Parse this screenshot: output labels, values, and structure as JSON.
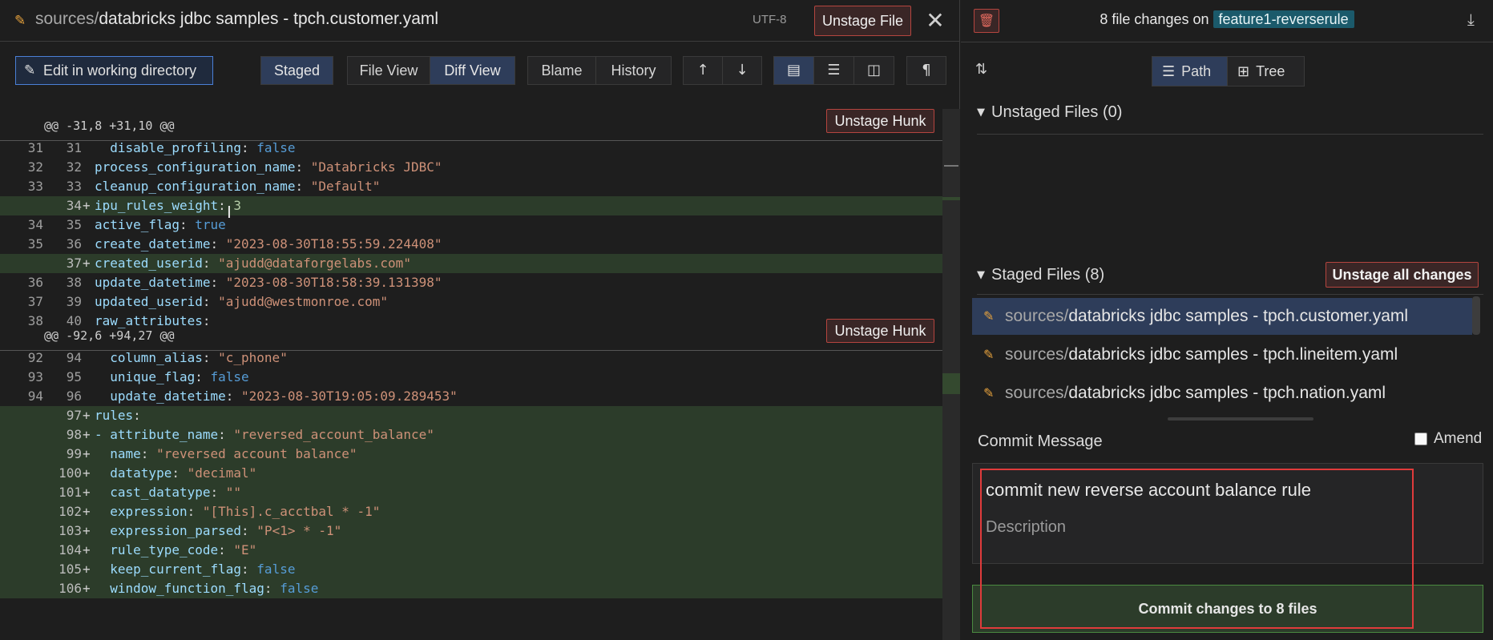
{
  "left": {
    "title_dir": "sources/",
    "title_file": "databricks jdbc samples - tpch.customer.yaml",
    "encoding": "UTF-8",
    "unstage_file_label": "Unstage File",
    "close_glyph": "✕",
    "toolbar": {
      "edit_label": "Edit in working directory",
      "staged_label": "Staged",
      "file_view_label": "File View",
      "diff_view_label": "Diff View",
      "blame_label": "Blame",
      "history_label": "History",
      "up_glyph": "🡡",
      "down_glyph": "🡣"
    },
    "hunks": [
      {
        "header": "@@ -31,8 +31,10 @@",
        "unstage_label": "Unstage Hunk",
        "lines": [
          {
            "o": "31",
            "n": "31",
            "m": "",
            "key": "  disable_profiling",
            "val": "false",
            "vt": "b"
          },
          {
            "o": "32",
            "n": "32",
            "m": "",
            "key": "process_configuration_name",
            "val": "\"Databricks JDBC\"",
            "vt": "s"
          },
          {
            "o": "33",
            "n": "33",
            "m": "",
            "key": "cleanup_configuration_name",
            "val": "\"Default\"",
            "vt": "s"
          },
          {
            "o": "",
            "n": "34",
            "m": "+",
            "key": "ipu_rules_weight",
            "val": "3",
            "vt": "n"
          },
          {
            "o": "34",
            "n": "35",
            "m": "",
            "key": "active_flag",
            "val": "true",
            "vt": "b"
          },
          {
            "o": "35",
            "n": "36",
            "m": "",
            "key": "create_datetime",
            "val": "\"2023-08-30T18:55:59.224408\"",
            "vt": "s"
          },
          {
            "o": "",
            "n": "37",
            "m": "+",
            "key": "created_userid",
            "val": "\"ajudd@dataforgelabs.com\"",
            "vt": "s"
          },
          {
            "o": "36",
            "n": "38",
            "m": "",
            "key": "update_datetime",
            "val": "\"2023-08-30T18:58:39.131398\"",
            "vt": "s"
          },
          {
            "o": "37",
            "n": "39",
            "m": "",
            "key": "updated_userid",
            "val": "\"ajudd@westmonroe.com\"",
            "vt": "s"
          },
          {
            "o": "38",
            "n": "40",
            "m": "",
            "key": "raw_attributes",
            "val": "",
            "vt": "p"
          }
        ]
      },
      {
        "header": "@@ -92,6 +94,27 @@",
        "unstage_label": "Unstage Hunk",
        "lines": [
          {
            "o": "92",
            "n": "94",
            "m": "",
            "key": "  column_alias",
            "val": "\"c_phone\"",
            "vt": "s"
          },
          {
            "o": "93",
            "n": "95",
            "m": "",
            "key": "  unique_flag",
            "val": "false",
            "vt": "b"
          },
          {
            "o": "94",
            "n": "96",
            "m": "",
            "key": "  update_datetime",
            "val": "\"2023-08-30T19:05:09.289453\"",
            "vt": "s"
          },
          {
            "o": "",
            "n": "97",
            "m": "+",
            "key": "rules",
            "val": "",
            "vt": "p"
          },
          {
            "o": "",
            "n": "98",
            "m": "+",
            "key": "- attribute_name",
            "val": "\"reversed_account_balance\"",
            "vt": "s"
          },
          {
            "o": "",
            "n": "99",
            "m": "+",
            "key": "  name",
            "val": "\"reversed account balance\"",
            "vt": "s"
          },
          {
            "o": "",
            "n": "100",
            "m": "+",
            "key": "  datatype",
            "val": "\"decimal\"",
            "vt": "s"
          },
          {
            "o": "",
            "n": "101",
            "m": "+",
            "key": "  cast_datatype",
            "val": "\"\"",
            "vt": "s"
          },
          {
            "o": "",
            "n": "102",
            "m": "+",
            "key": "  expression",
            "val": "\"[This].c_acctbal * -1\"",
            "vt": "s"
          },
          {
            "o": "",
            "n": "103",
            "m": "+",
            "key": "  expression_parsed",
            "val": "\"P<1> * -1\"",
            "vt": "s"
          },
          {
            "o": "",
            "n": "104",
            "m": "+",
            "key": "  rule_type_code",
            "val": "\"E\"",
            "vt": "s"
          },
          {
            "o": "",
            "n": "105",
            "m": "+",
            "key": "  keep_current_flag",
            "val": "false",
            "vt": "b"
          },
          {
            "o": "",
            "n": "106",
            "m": "+",
            "key": "  window_function_flag",
            "val": "false",
            "vt": "b"
          }
        ]
      }
    ]
  },
  "right": {
    "changes_prefix": "8 file changes on",
    "branch": "feature1-reverserule",
    "path_label": "Path",
    "tree_label": "Tree",
    "unstaged_header": "Unstaged Files (0)",
    "staged_header": "Staged Files (8)",
    "unstage_all_label": "Unstage all changes",
    "staged_files": [
      {
        "dir": "sources/",
        "name": "databricks jdbc samples - tpch.customer.yaml"
      },
      {
        "dir": "sources/",
        "name": "databricks jdbc samples - tpch.lineitem.yaml"
      },
      {
        "dir": "sources/",
        "name": "databricks jdbc samples - tpch.nation.yaml"
      }
    ],
    "commit_message_label": "Commit Message",
    "amend_label": "Amend",
    "commit_summary": "commit new reverse account balance rule",
    "description_placeholder": "Description",
    "commit_button_label": "Commit changes to 8 files"
  },
  "colors": {
    "added_line_bg": "#2c3c2a",
    "danger_border": "#b5453f",
    "selected_bg": "#2e3d5a",
    "branch_bg": "#1b5a6b",
    "annotation_red": "#e03b3b"
  }
}
